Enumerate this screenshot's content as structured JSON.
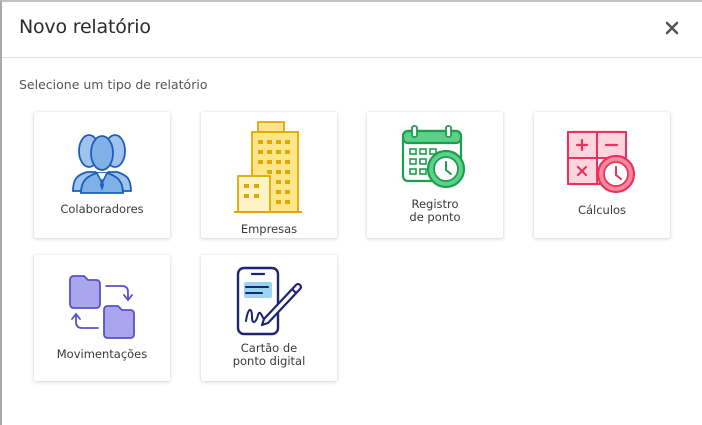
{
  "dialog": {
    "title": "Novo relatório",
    "close_symbol": "×",
    "subtitle": "Selecione um tipo de relatório"
  },
  "report_types": [
    {
      "label": "Colaboradores",
      "icon": "people-icon",
      "color": "#3b82d6"
    },
    {
      "label": "Empresas",
      "icon": "building-icon",
      "color": "#f2b619"
    },
    {
      "label": "Registro de ponto",
      "icon": "calendar-clock-icon",
      "color": "#2db356"
    },
    {
      "label": "Cálculos",
      "icon": "calculator-clock-icon",
      "color": "#ee3e66"
    },
    {
      "label": "Movimentações",
      "icon": "folders-transfer-icon",
      "color": "#6b63d6"
    },
    {
      "label": "Cartão de ponto digital",
      "icon": "mobile-signature-icon",
      "color": "#232b8c"
    }
  ]
}
